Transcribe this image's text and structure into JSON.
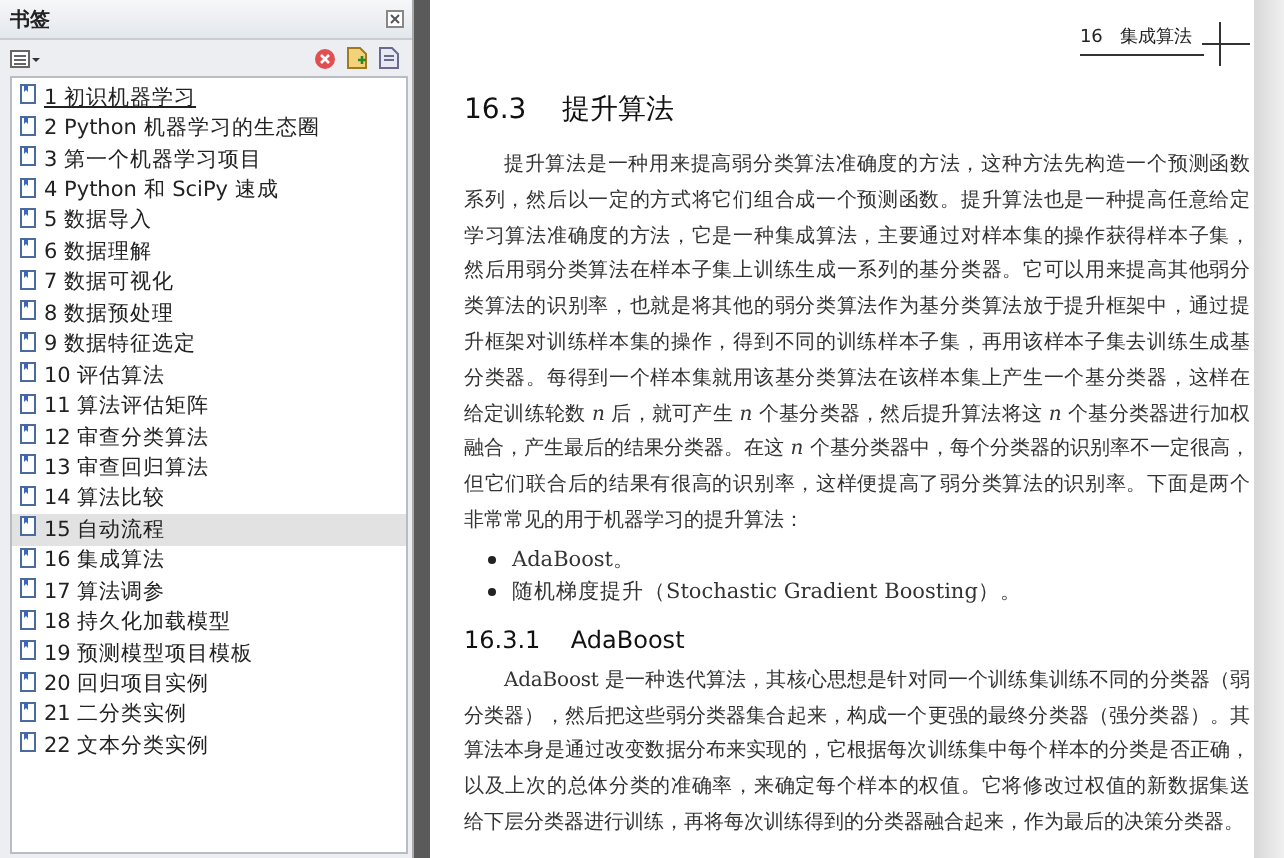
{
  "sidebar": {
    "title": "书签",
    "bookmarks": [
      {
        "label": "1 初识机器学习",
        "selected": false,
        "focused": true
      },
      {
        "label": "2 Python 机器学习的生态圈",
        "selected": false,
        "focused": false
      },
      {
        "label": "3 第一个机器学习项目",
        "selected": false,
        "focused": false
      },
      {
        "label": "4 Python 和 SciPy 速成",
        "selected": false,
        "focused": false
      },
      {
        "label": "5 数据导入",
        "selected": false,
        "focused": false
      },
      {
        "label": "6 数据理解",
        "selected": false,
        "focused": false
      },
      {
        "label": "7 数据可视化",
        "selected": false,
        "focused": false
      },
      {
        "label": "8 数据预处理",
        "selected": false,
        "focused": false
      },
      {
        "label": "9 数据特征选定",
        "selected": false,
        "focused": false
      },
      {
        "label": "10 评估算法",
        "selected": false,
        "focused": false
      },
      {
        "label": "11 算法评估矩阵",
        "selected": false,
        "focused": false
      },
      {
        "label": "12 审查分类算法",
        "selected": false,
        "focused": false
      },
      {
        "label": "13 审查回归算法",
        "selected": false,
        "focused": false
      },
      {
        "label": "14 算法比较",
        "selected": false,
        "focused": false
      },
      {
        "label": "15 自动流程",
        "selected": true,
        "focused": false
      },
      {
        "label": "16 集成算法",
        "selected": false,
        "focused": false
      },
      {
        "label": "17 算法调参",
        "selected": false,
        "focused": false
      },
      {
        "label": "18 持久化加载模型",
        "selected": false,
        "focused": false
      },
      {
        "label": "19 预测模型项目模板",
        "selected": false,
        "focused": false
      },
      {
        "label": "20 回归项目实例",
        "selected": false,
        "focused": false
      },
      {
        "label": "21 二分类实例",
        "selected": false,
        "focused": false
      },
      {
        "label": "22 文本分类实例",
        "selected": false,
        "focused": false
      }
    ]
  },
  "page": {
    "running_header": {
      "chapter": "16",
      "title": "集成算法"
    },
    "blocks": [
      {
        "kind": "heading",
        "number": "16.3",
        "title": "提升算法"
      },
      {
        "kind": "paragraph",
        "lines": [
          "提升算法是一种用来提高弱分类算法准确度的方法，这种方法先构造一个预测函数",
          "系列，然后以一定的方式将它们组合成一个预测函数。提升算法也是一种提高任意给定",
          "学习算法准确度的方法，它是一种集成算法，主要通过对样本集的操作获得样本子集，",
          "然后用弱分类算法在样本子集上训练生成一系列的基分类器。它可以用来提高其他弱分",
          "类算法的识别率，也就是将其他的弱分类算法作为基分类算法放于提升框架中，通过提",
          "升框架对训练样本集的操作，得到不同的训练样本子集，再用该样本子集去训练生成基",
          "分类器。每得到一个样本集就用该基分类算法在该样本集上产生一个基分类器，这样在",
          "给定训练轮数 *n* 后，就可产生 *n* 个基分类器，然后提升算法将这 *n* 个基分类器进行加权",
          "融合，产生最后的结果分类器。在这 *n* 个基分类器中，每个分类器的识别率不一定很高，",
          "但它们联合后的结果有很高的识别率，这样便提高了弱分类算法的识别率。下面是两个",
          "非常常见的用于机器学习的提升算法："
        ]
      },
      {
        "kind": "bullets",
        "items": [
          "AdaBoost。",
          "随机梯度提升（Stochastic Gradient Boosting）。"
        ]
      },
      {
        "kind": "subheading",
        "number": "16.3.1",
        "title": "AdaBoost"
      },
      {
        "kind": "paragraph",
        "lines": [
          "AdaBoost 是一种迭代算法，其核心思想是针对同一个训练集训练不同的分类器（弱",
          "分类器），然后把这些弱分类器集合起来，构成一个更强的最终分类器（强分类器）。其",
          "算法本身是通过改变数据分布来实现的，它根据每次训练集中每个样本的分类是否正确，",
          "以及上次的总体分类的准确率，来确定每个样本的权值。它将修改过权值的新数据集送",
          "给下层分类器进行训练，再将每次训练得到的分类器融合起来，作为最后的决策分类器。"
        ]
      }
    ]
  }
}
